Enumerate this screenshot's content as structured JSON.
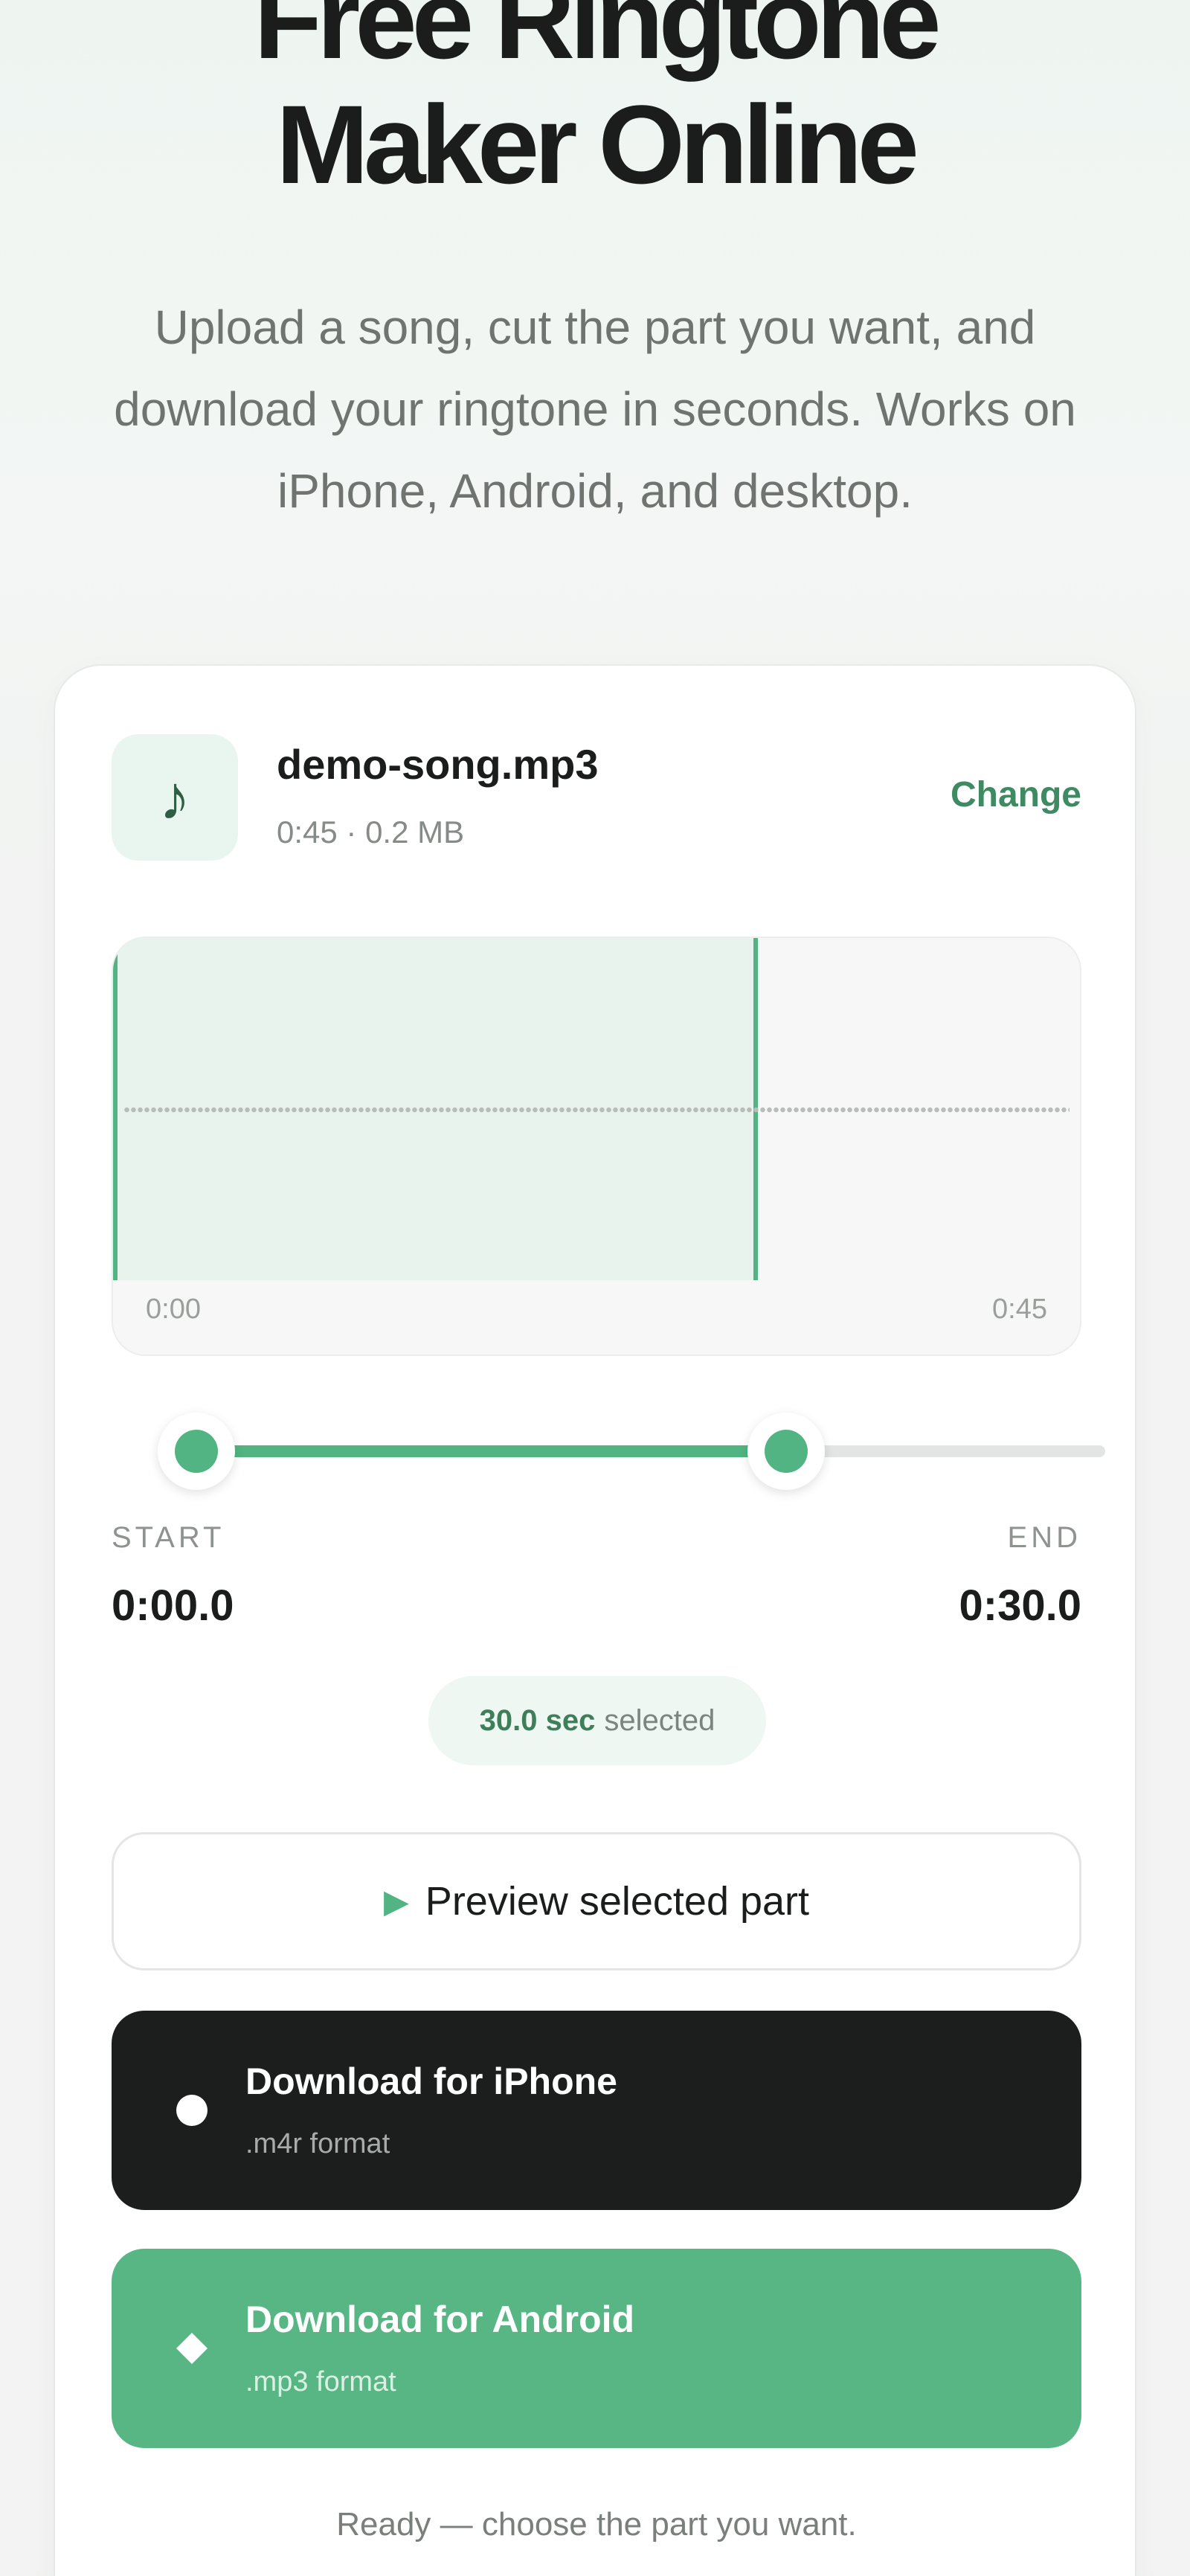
{
  "hero": {
    "title_line1": "Free Ringtone",
    "title_line2": "Maker Online",
    "subtitle": "Upload a song, cut the part you want, and download your ringtone in seconds. Works on iPhone, Android, and desktop."
  },
  "file": {
    "icon": "music-note-icon",
    "name": "demo-song.mp3",
    "meta": "0:45 · 0.2 MB",
    "change_label": "Change"
  },
  "waveform": {
    "start_time": "0:00",
    "end_time": "0:45",
    "duration_seconds": 45,
    "selection_start_seconds": 0,
    "selection_end_seconds": 30
  },
  "range": {
    "start_label": "START",
    "end_label": "END",
    "start_value": "0:00.0",
    "end_value": "0:30.0"
  },
  "selection": {
    "amount": "30.0 sec",
    "suffix": "selected"
  },
  "buttons": {
    "preview_icon": "play-icon",
    "preview_label": "Preview selected part",
    "iphone_icon": "circle-icon",
    "iphone_title": "Download for iPhone",
    "iphone_sub": ".m4r format",
    "android_icon": "diamond-icon",
    "android_title": "Download for Android",
    "android_sub": ".mp3 format"
  },
  "status": "Ready — choose the part you want.",
  "colors": {
    "accent": "#52b482",
    "accent_text": "#3e8a62",
    "dark": "#1b1e1d"
  }
}
